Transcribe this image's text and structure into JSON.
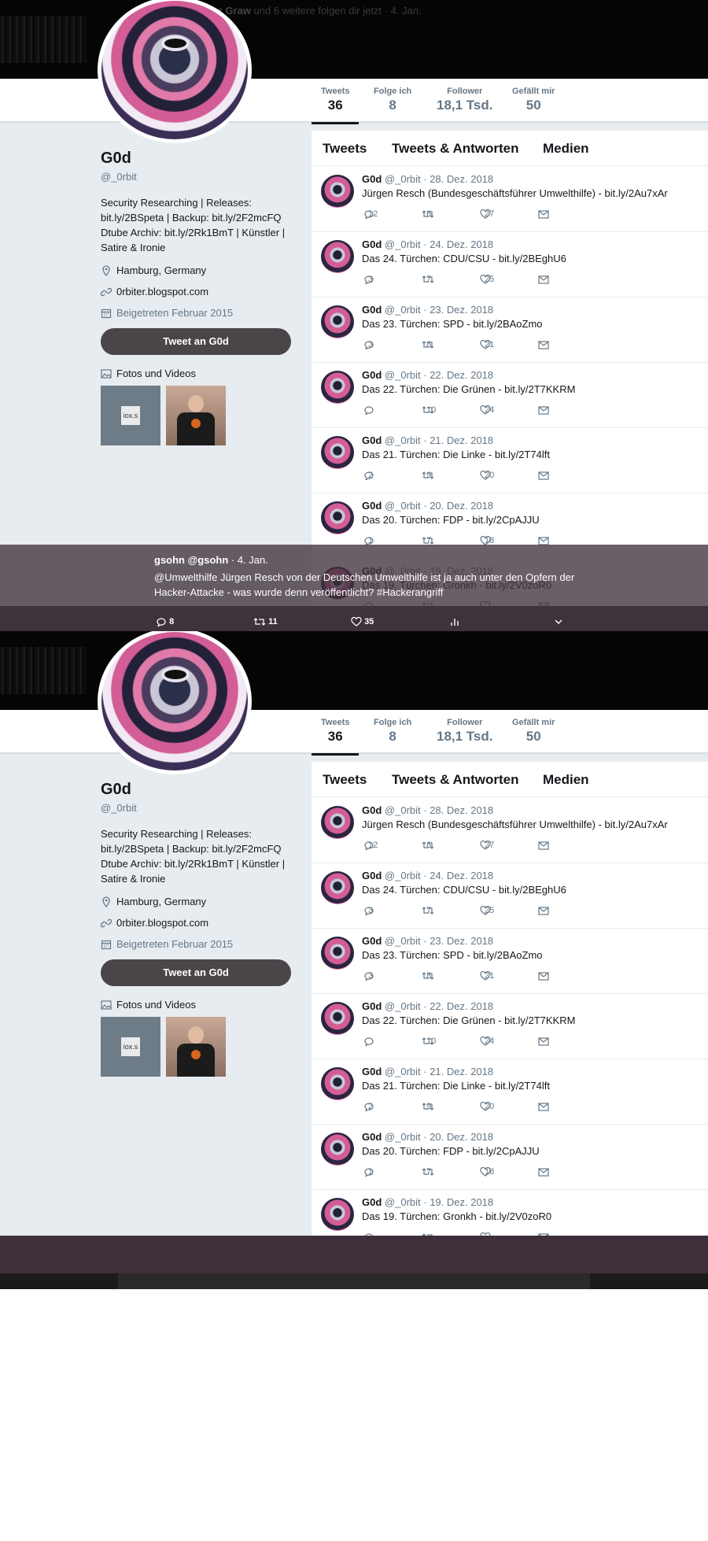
{
  "notice": {
    "name": "Ansgar Graw",
    "rest": "und 6 weitere folgen dir jetzt · 4. Jan."
  },
  "nav": [
    {
      "label": "Tweets",
      "value": "36"
    },
    {
      "label": "Folge ich",
      "value": "8"
    },
    {
      "label": "Follower",
      "value": "18,1 Tsd."
    },
    {
      "label": "Gefällt mir",
      "value": "50"
    }
  ],
  "profile": {
    "name": "G0d",
    "handle": "@_0rbit",
    "bio": "Security Researching | Releases: bit.ly/2BSpeta | Backup: bit.ly/2F2mcFQ Dtube Archiv: bit.ly/2Rk1BmT | Künstler | Satire & Ironie",
    "location": "Hamburg, Germany",
    "website": "0rbiter.blogspot.com",
    "joined": "Beigetreten Februar 2015",
    "tweet_button": "Tweet an G0d",
    "photos_label": "Fotos und Videos",
    "thumb_text": "iox.s"
  },
  "tabs": [
    "Tweets",
    "Tweets & Antworten",
    "Medien"
  ],
  "tweets": [
    {
      "name": "G0d",
      "meta": "@_0rbit · 28. Dez. 2018",
      "text": "Jürgen Resch (Bundesgeschäftsführer Umwelthilfe) - bit.ly/2Au7xAr",
      "replies": "12",
      "retweets": "6",
      "likes": "27"
    },
    {
      "name": "G0d",
      "meta": "@_0rbit · 24. Dez. 2018",
      "text": "Das 24. Türchen: CDU/CSU - bit.ly/2BEghU6",
      "replies": "3",
      "retweets": "7",
      "likes": "25"
    },
    {
      "name": "G0d",
      "meta": "@_0rbit · 23. Dez. 2018",
      "text": "Das 23. Türchen: SPD - bit.ly/2BAoZmo",
      "replies": "3",
      "retweets": "8",
      "likes": "21"
    },
    {
      "name": "G0d",
      "meta": "@_0rbit · 22. Dez. 2018",
      "text": "Das 22. Türchen: Die Grünen - bit.ly/2T7KKRM",
      "replies": "",
      "retweets": "10",
      "likes": "24"
    },
    {
      "name": "G0d",
      "meta": "@_0rbit · 21. Dez. 2018",
      "text": "Das 21. Türchen: Die Linke - bit.ly/2T74lft",
      "replies": "2",
      "retweets": "9",
      "likes": "20"
    },
    {
      "name": "G0d",
      "meta": "@_0rbit · 20. Dez. 2018",
      "text": "Das 20. Türchen: FDP - bit.ly/2CpAJJU",
      "replies": "1",
      "retweets": "7",
      "likes": "18"
    },
    {
      "name": "G0d",
      "meta": "@_0rbit · 19. Dez. 2018",
      "text": "Das 19. Türchen: Gronkh - bit.ly/2V0zoR0",
      "replies": "",
      "retweets": "",
      "likes": ""
    }
  ],
  "overlay": {
    "user": "gsohn @gsohn",
    "date": "· 4. Jan.",
    "text": "@Umwelthilfe Jürgen Resch von der Deutschen Umwelthilfe ist ja auch unter den Opfern der Hacker-Attacke - was wurde denn veröffentlicht? #Hackerangriff",
    "replies": "8",
    "retweets": "11",
    "likes": "35"
  }
}
